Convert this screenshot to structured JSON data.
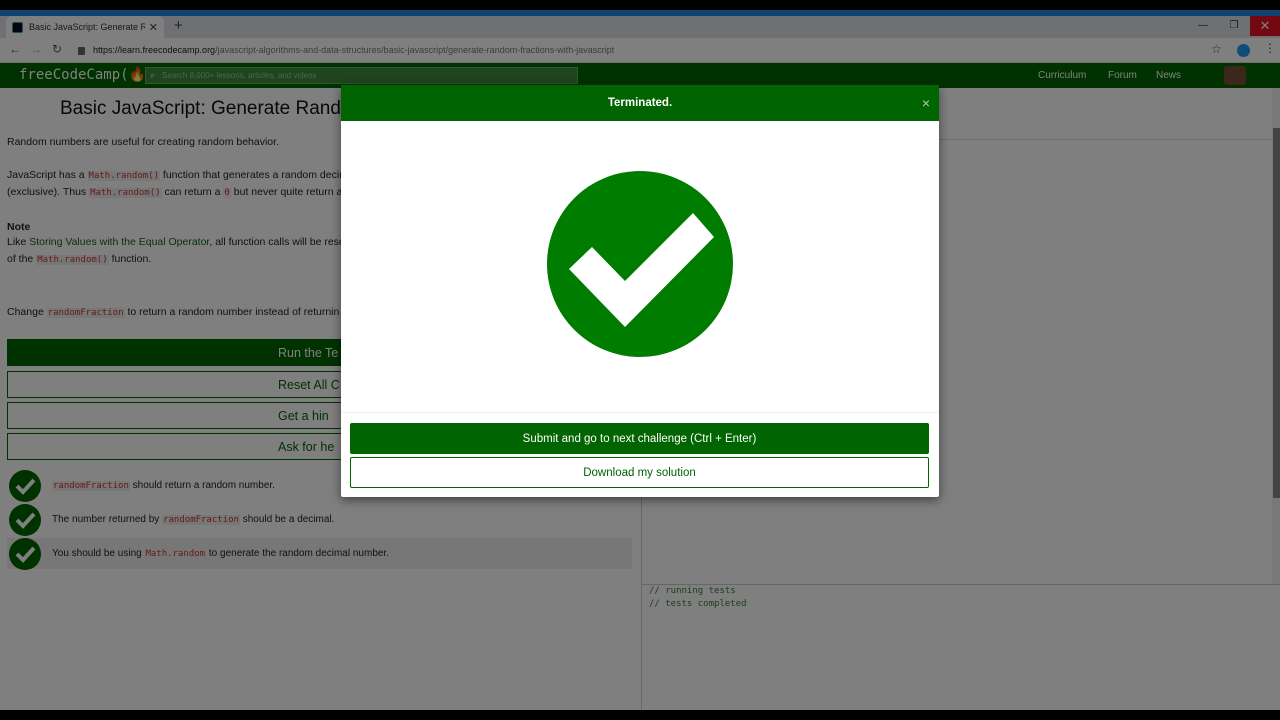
{
  "browser": {
    "tab_title": "Basic JavaScript: Generate Rando",
    "tab_close": "✕",
    "new_tab": "+",
    "url_host": "https://learn.freecodecamp.org",
    "url_path": "/javascript-algorithms-and-data-structures/basic-javascript/generate-random-fractions-with-javascript",
    "min": "—",
    "max": "❐",
    "close": "✕"
  },
  "navbar": {
    "logo": "freeCodeCamp(🔥)",
    "search_placeholder": "Search 8,000+ lessons, articles, and videos",
    "links": [
      "Curriculum",
      "Forum",
      "News"
    ]
  },
  "challenge": {
    "title": "Basic JavaScript: Generate Rando",
    "p1": "Random numbers are useful for creating random behavior.",
    "p2_a": "JavaScript has a ",
    "p2_code": "Math.random()",
    "p2_b": " function that generates a random decim",
    "p3_a": "(exclusive). Thus ",
    "p3_code": "Math.random()",
    "p3_b": " can return a ",
    "p3_code2": "0",
    "p3_c": " but never quite return a",
    "note_label": "Note",
    "note_a": "Like ",
    "note_link": "Storing Values with the Equal Operator",
    "note_b": ", all function calls will be reso",
    "note2_a": "of the ",
    "note2_code": "Math.random()",
    "note2_b": " function.",
    "task_a": "Change ",
    "task_code": "randomFraction",
    "task_b": " to return a random number instead of returnin"
  },
  "buttons": {
    "run": "Run the Te",
    "reset": "Reset All C",
    "hint": "Get a hin",
    "help": "Ask for he"
  },
  "tests": [
    {
      "code": "randomFraction",
      "text": " should return a random number."
    },
    {
      "prefix": "The number returned by ",
      "code": "randomFraction",
      "text": " should be a decimal."
    },
    {
      "prefix": "You should be using ",
      "code": "Math.random",
      "text": " to generate the random decimal number."
    }
  ],
  "console": {
    "line1": "// running tests",
    "line2": "// tests completed"
  },
  "modal": {
    "title": "Terminated.",
    "close": "×",
    "submit": "Submit and go to next challenge (Ctrl + Enter)",
    "download": "Download my solution"
  },
  "colors": {
    "fcc_green": "#006400",
    "close_red": "#e81123"
  }
}
